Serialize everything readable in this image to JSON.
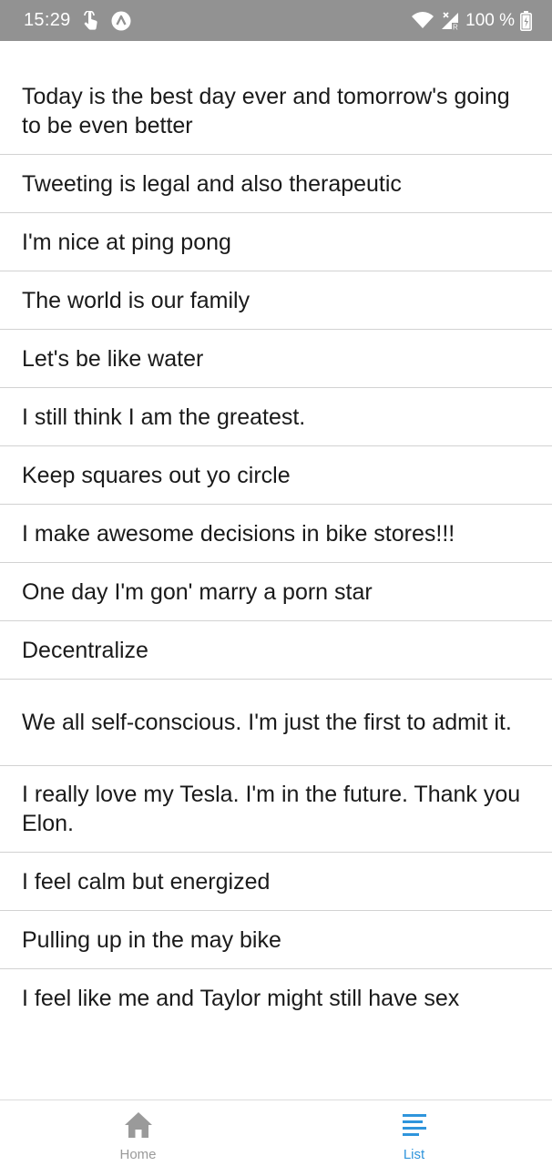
{
  "status_bar": {
    "time": "15:29",
    "battery": "100 %",
    "icons": [
      "touch-icon",
      "app-notification-icon",
      "wifi-icon",
      "signal-icon",
      "battery-icon"
    ]
  },
  "list": {
    "items": [
      {
        "text": "Today is the best day ever and tomorrow's going to be even better"
      },
      {
        "text": "Tweeting is legal and also therapeutic"
      },
      {
        "text": "I'm nice at ping pong"
      },
      {
        "text": "The world is our family"
      },
      {
        "text": "Let's be like water"
      },
      {
        "text": "I still think I am the greatest."
      },
      {
        "text": "Keep squares out yo circle"
      },
      {
        "text": "I make awesome decisions in bike stores!!!"
      },
      {
        "text": "One day I'm gon' marry a porn star"
      },
      {
        "text": "Decentralize"
      },
      {
        "text": "We all self-conscious. I'm just the first to admit it."
      },
      {
        "text": "I really love my Tesla. I'm in the future. Thank you Elon."
      },
      {
        "text": "I feel calm but energized"
      },
      {
        "text": "Pulling up in the may bike"
      },
      {
        "text": "I feel like me and Taylor might still have sex"
      }
    ]
  },
  "bottom_nav": {
    "tabs": [
      {
        "label": "Home",
        "icon": "home-icon",
        "active": false
      },
      {
        "label": "List",
        "icon": "list-icon",
        "active": true
      }
    ]
  },
  "colors": {
    "status_bar": "#929292",
    "active_tab": "#2f95dc",
    "inactive_tab": "#9a9a9a",
    "divider": "#d2d2d2"
  }
}
